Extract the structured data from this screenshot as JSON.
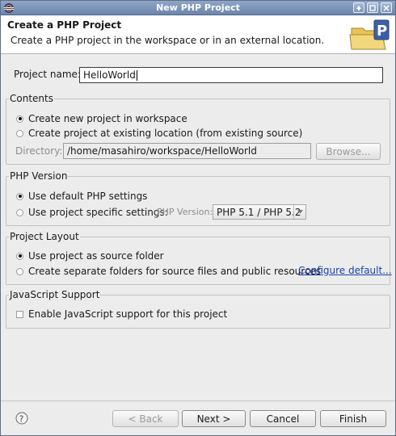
{
  "window": {
    "title": "New PHP Project"
  },
  "header": {
    "title": "Create a PHP Project",
    "description": "Create a PHP project in the workspace or in an external location."
  },
  "project_name": {
    "label": "Project name:",
    "value": "HelloWorld"
  },
  "contents": {
    "title": "Contents",
    "option_new": "Create new project in workspace",
    "option_existing": "Create project at existing location (from existing source)",
    "directory_label": "Directory:",
    "directory_value": "/home/masahiro/workspace/HelloWorld",
    "browse_label": "Browse..."
  },
  "php_version": {
    "title": "PHP Version",
    "option_default": "Use default PHP settings",
    "option_specific": "Use project specific settings:",
    "version_label": "PHP Version:",
    "version_selected": "PHP 5.1 / PHP 5.2"
  },
  "layout": {
    "title": "Project Layout",
    "option_source": "Use project as source folder",
    "option_separate": "Create separate folders for source files and public resources",
    "configure_link": "Configure default..."
  },
  "javascript": {
    "title": "JavaScript Support",
    "enable_label": "Enable JavaScript support for this project"
  },
  "buttons": {
    "back": "< Back",
    "next": "Next >",
    "cancel": "Cancel",
    "finish": "Finish"
  }
}
